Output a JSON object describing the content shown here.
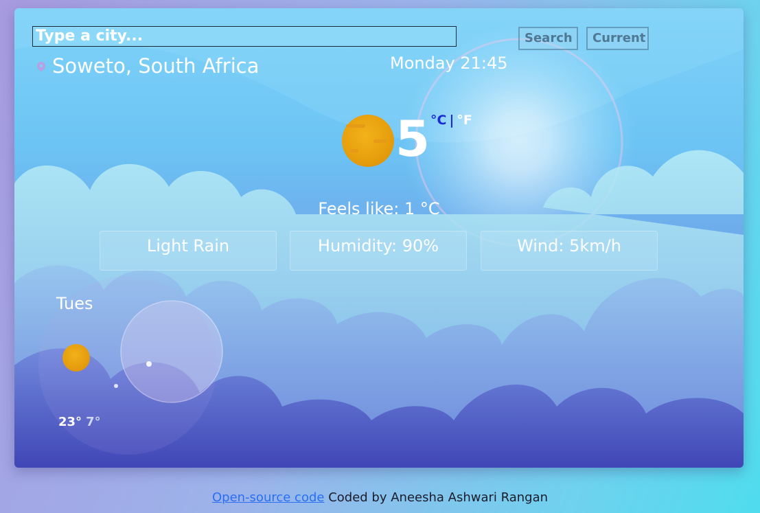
{
  "search": {
    "placeholder": "Type a city...",
    "search_label": "Search",
    "current_label": "Current"
  },
  "location": {
    "city": "Soweto, South Africa",
    "icon": "map-pin-icon"
  },
  "datetime": "Monday 21:45",
  "current": {
    "icon": "sun-icon",
    "temperature": "5",
    "unit_c": "°C",
    "unit_sep": "|",
    "unit_f": "°F",
    "feels_like": "Feels like: 1 °C",
    "description": "Light Rain",
    "humidity": "Humidity: 90%",
    "wind": "Wind: 5km/h"
  },
  "forecast": [
    {
      "day": "Tues",
      "icon": "sun-icon",
      "max": "23°",
      "min": "7°"
    }
  ],
  "footer": {
    "link": "Open-source code",
    "credit": " Coded by Aneesha Ashwari Rangan"
  },
  "colors": {
    "link": "#2a6ff2",
    "unit_active": "#1a2bd8",
    "sun": "#f2b21a"
  }
}
